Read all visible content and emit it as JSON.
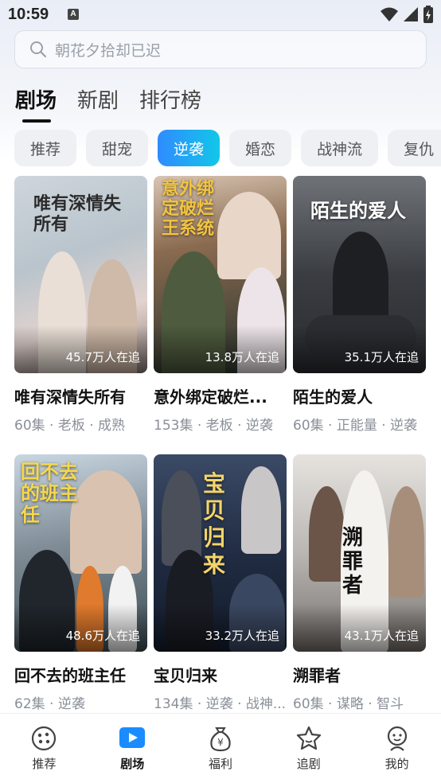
{
  "status": {
    "time": "10:59",
    "notif": "A"
  },
  "search": {
    "placeholder": "朝花夕拾却已迟"
  },
  "top_tabs": [
    {
      "label": "剧场",
      "active": true
    },
    {
      "label": "新剧",
      "active": false
    },
    {
      "label": "排行榜",
      "active": false
    }
  ],
  "chips": [
    "推荐",
    "甜宠",
    "逆袭",
    "婚恋",
    "战神流",
    "复仇"
  ],
  "active_chip": "逆袭",
  "dramas": [
    {
      "title": "唯有深情失所有",
      "meta": "60集 · 老板 · 成熟",
      "views": "45.7万人在追",
      "poster_title": "唯有深情失所有"
    },
    {
      "title": "意外绑定破烂...",
      "meta": "153集 · 老板 · 逆袭",
      "views": "13.8万人在追",
      "poster_title": "意外绑定破烂王系统"
    },
    {
      "title": "陌生的爱人",
      "meta": "60集 · 正能量 · 逆袭",
      "views": "35.1万人在追",
      "poster_title": "陌生的爱人"
    },
    {
      "title": "回不去的班主任",
      "meta": "62集 · 逆袭",
      "views": "48.6万人在追",
      "poster_title": "回不去的班主任"
    },
    {
      "title": "宝贝归来",
      "meta": "134集 · 逆袭 · 战神...",
      "views": "33.2万人在追",
      "poster_title": "宝贝归来"
    },
    {
      "title": "溯罪者",
      "meta": "60集 · 谋略 · 智斗",
      "views": "43.1万人在追",
      "poster_title": "溯罪者"
    }
  ],
  "bottom_nav": [
    {
      "label": "推荐",
      "icon": "discover-icon",
      "active": false
    },
    {
      "label": "剧场",
      "icon": "play-icon",
      "active": true
    },
    {
      "label": "福利",
      "icon": "money-bag-icon",
      "active": false
    },
    {
      "label": "追剧",
      "icon": "star-icon",
      "active": false
    },
    {
      "label": "我的",
      "icon": "profile-icon",
      "active": false
    }
  ],
  "colors": {
    "accent_start": "#2f8bff",
    "accent_end": "#12c7e8",
    "play_icon": "#1b8cff"
  }
}
